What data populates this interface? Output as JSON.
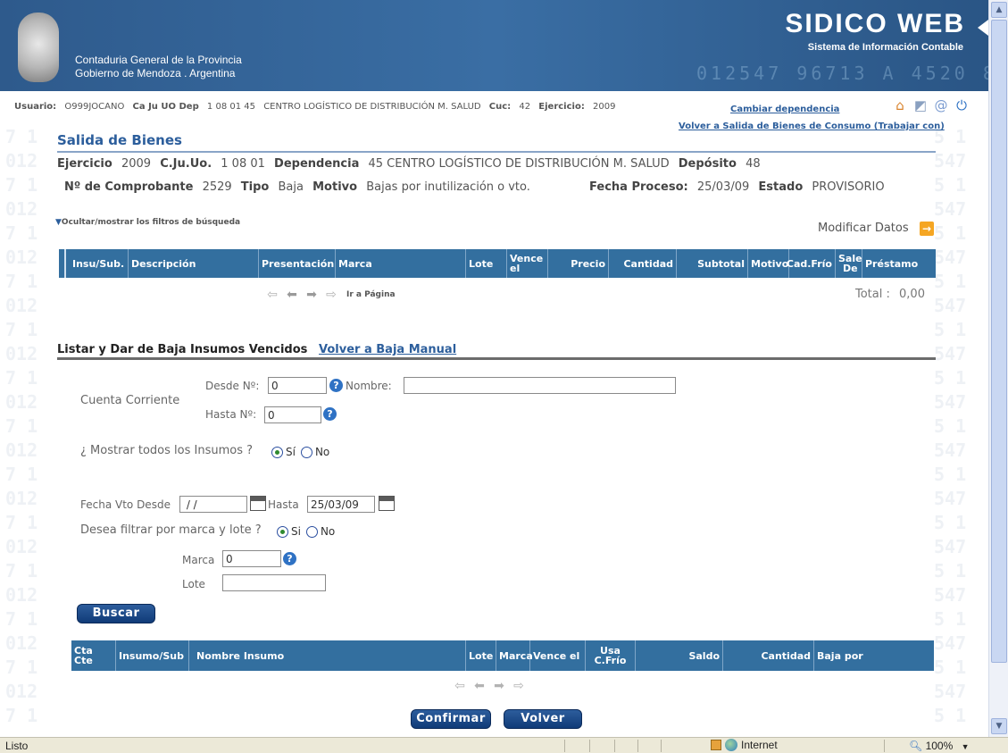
{
  "header": {
    "org_line1": "Contaduria General de la Provincia",
    "org_line2": "Gobierno de Mendoza . Argentina",
    "app_title": "SIDICO  WEB",
    "app_subtitle": "Sistema de Información Contable",
    "digits": "012547  96713 A 4520 8"
  },
  "userbar": {
    "usuario_label": "Usuario:",
    "usuario": "O999JOCANO",
    "cajuuo_label": "Ca Ju UO Dep",
    "cajuuo": "1  08  01  45",
    "dependencia": "CENTRO LOGÍSTICO DE DISTRIBUCIÓN M. SALUD",
    "cuc_label": "Cuc:",
    "cuc": "42",
    "ejercicio_label": "Ejercicio:",
    "ejercicio": "2009",
    "cambiar_link": "Cambiar dependencia",
    "volver_link": "Volver a Salida de Bienes de Consumo (Trabajar con)",
    "icons": [
      "home-icon",
      "folder-icon",
      "email-icon",
      "power-icon"
    ]
  },
  "page": {
    "title": "Salida de Bienes",
    "ejercicio_label": "Ejercicio",
    "ejercicio": "2009",
    "cjuo_label": "C.Ju.Uo.",
    "cjuo": "1  08  01",
    "dependencia_label": "Dependencia",
    "dependencia": "45  CENTRO LOGÍSTICO DE DISTRIBUCIÓN M. SALUD",
    "deposito_label": "Depósito",
    "deposito": "48",
    "comprobante_label": "Nº de Comprobante",
    "comprobante": "2529",
    "tipo_label": "Tipo",
    "tipo": "Baja",
    "motivo_label": "Motivo",
    "motivo": "Bajas por inutilización o vto.",
    "fecha_label": "Fecha Proceso:",
    "fecha": "25/03/09",
    "estado_label": "Estado",
    "estado": "PROVISORIO",
    "toggle_filters": "Ocultar/mostrar los filtros de búsqueda",
    "modificar": "Modificar Datos"
  },
  "table1": {
    "headers": [
      "Insu/Sub.",
      "Descripción",
      "Presentación",
      "Marca",
      "Lote",
      "Vence el",
      "Precio",
      "Cantidad",
      "Subtotal",
      "Motivo",
      "Cad.Frío",
      "Sale De",
      "Préstamo"
    ],
    "ir_pagina": "Ir a Página",
    "total_label": "Total :",
    "total_value": "0,00"
  },
  "section2": {
    "title": "Listar y Dar de Baja Insumos Vencidos",
    "back_link": "Volver a Baja Manual",
    "cuenta_label": "Cuenta Corriente",
    "desde_label": "Desde Nº:",
    "desde_value": "0",
    "nombre_label": "Nombre:",
    "nombre_value": "",
    "hasta_label": "Hasta Nº:",
    "hasta_value": "0",
    "mostrar_label": "¿ Mostrar todos los Insumos ?",
    "mostrar_si": "Sí",
    "mostrar_no": "No",
    "fecha_desde_label": "Fecha Vto Desde",
    "fecha_desde_value": " / /",
    "fecha_hasta_label": "Hasta",
    "fecha_hasta_value": "25/03/09",
    "filtrar_label": "Desea filtrar por marca y lote ?",
    "filtrar_si": "Si",
    "filtrar_no": "No",
    "marca_label": "Marca",
    "marca_value": "0",
    "lote_label": "Lote",
    "lote_value": "",
    "buscar": "Buscar"
  },
  "table2": {
    "headers": [
      "Cta Cte",
      "Insumo/Sub",
      "Nombre Insumo",
      "Lote",
      "Marca",
      "Vence el",
      "Usa C.Frío",
      "Saldo",
      "Cantidad",
      "Baja por"
    ]
  },
  "actions": {
    "confirmar": "Confirmar",
    "volver": "Volver"
  },
  "statusbar": {
    "status": "Listo",
    "zone": "Internet",
    "zoom": "100%"
  }
}
